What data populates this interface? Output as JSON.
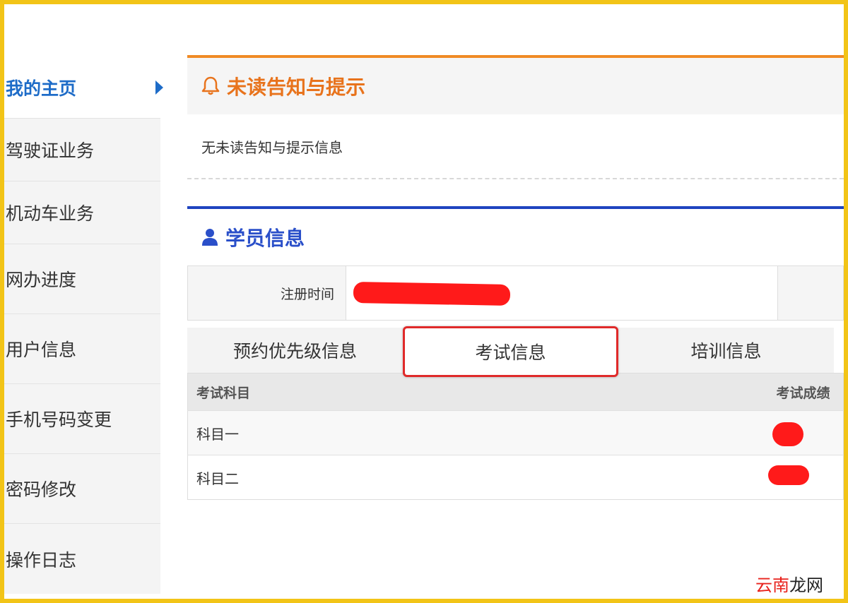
{
  "sidebar": {
    "items": [
      {
        "label": "我的主页",
        "active": true
      },
      {
        "label": "驾驶证业务"
      },
      {
        "label": "机动车业务"
      },
      {
        "label": "网办进度"
      },
      {
        "label": "用户信息"
      },
      {
        "label": "手机号码变更"
      },
      {
        "label": "密码修改"
      },
      {
        "label": "操作日志"
      }
    ]
  },
  "notice": {
    "title": "未读告知与提示",
    "body": "无未读告知与提示信息"
  },
  "student": {
    "title": "学员信息",
    "reg_label": "注册时间"
  },
  "tabs": [
    {
      "label": "预约优先级信息"
    },
    {
      "label": "考试信息",
      "active": true
    },
    {
      "label": "培训信息"
    }
  ],
  "exam_table": {
    "headers": [
      "考试科目",
      "考试成绩"
    ],
    "rows": [
      {
        "subject": "科目一"
      },
      {
        "subject": "科目二"
      }
    ]
  },
  "watermark": {
    "part1": "云南",
    "part2": "龙网"
  },
  "colors": {
    "accent_blue": "#1e6cc8",
    "notice_orange": "#e8731c",
    "student_blue": "#2a4fc9",
    "highlight_red": "#e02a2a",
    "frame_yellow": "#f2c417"
  }
}
